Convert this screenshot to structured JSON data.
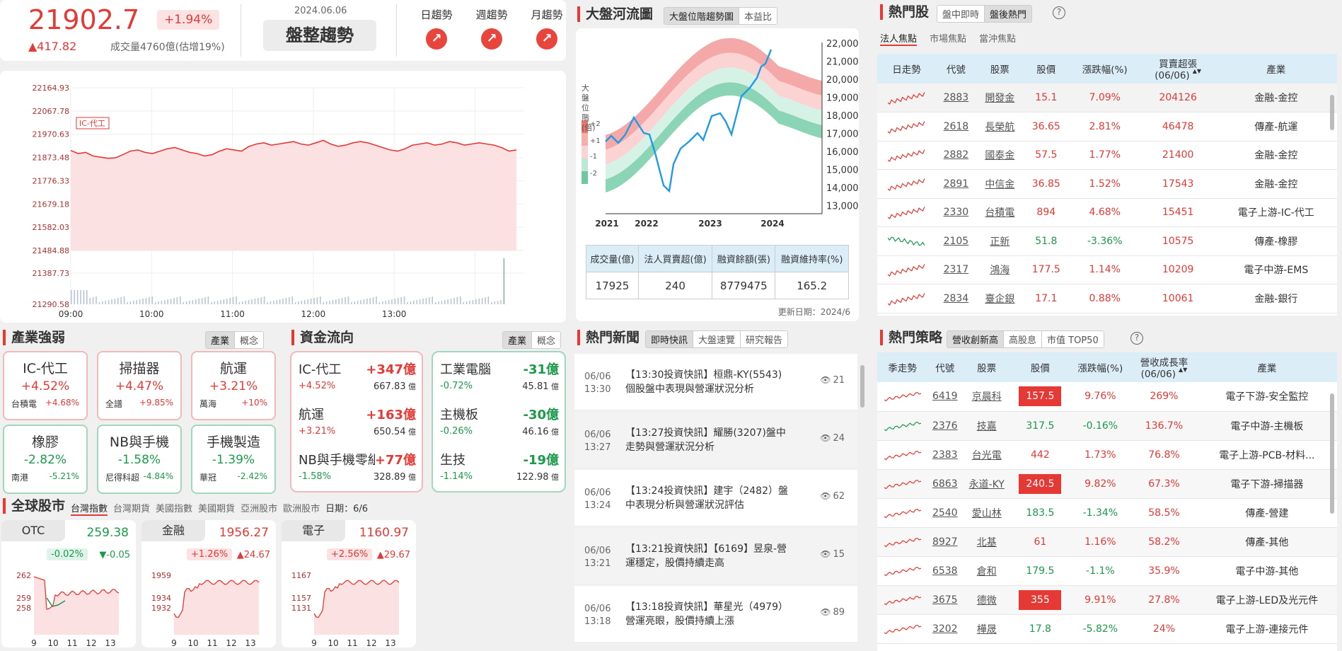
{
  "header": {
    "index": "21902.7",
    "change": "▲417.82",
    "pct": "+1.94%",
    "volume": "成交量4760億(估增19%)",
    "date": "2024.06.06",
    "trend": "盤整趨勢",
    "trend_tabs": [
      "日趨勢",
      "週趨勢",
      "月趨勢"
    ]
  },
  "intraday": {
    "ylabels": [
      "22164.93",
      "22067.78",
      "21970.63",
      "21873.48",
      "21776.33",
      "21679.18",
      "21582.03",
      "21484.88"
    ],
    "vol_labels": [
      "21387.73",
      "21290.58"
    ],
    "xlabels": [
      "09:00",
      "10:00",
      "11:00",
      "12:00",
      "13:00"
    ],
    "annotation": "IC-代工"
  },
  "river": {
    "title": "大盤河流圖",
    "tabs": [
      "大盤位階趨勢圖",
      "本益比"
    ],
    "side_label": "大盤位階(倍)",
    "band_labels": [
      "+2",
      "+1",
      "-1",
      "-2"
    ],
    "yaxis": [
      "22,000",
      "21,000",
      "20,000",
      "19,000",
      "18,000",
      "17,000",
      "16,000",
      "15,000",
      "14,000",
      "13,000"
    ],
    "xaxis": [
      "2021",
      "2022",
      "2023",
      "2024"
    ],
    "table_headers": [
      "成交量(億)",
      "法人買賣超(億)",
      "融資餘額(張)",
      "融資維持率(%)"
    ],
    "table_values": [
      "17925",
      "240",
      "8779475",
      "165.2"
    ],
    "update": "更新日期：2024/6"
  },
  "hot": {
    "title": "熱門股",
    "tabs": [
      "盤中即時",
      "盤後熱門"
    ],
    "subtabs": [
      "法人焦點",
      "市場焦點",
      "當沖焦點"
    ],
    "headers": [
      "日走勢",
      "代號",
      "股票",
      "股價",
      "漲跌幅(%)",
      "買賣超張\n(06/06)",
      "產業"
    ],
    "rows": [
      [
        "2883",
        "開發金",
        "15.1",
        "7.09%",
        "204126",
        "金融-金控"
      ],
      [
        "2618",
        "長榮航",
        "36.65",
        "2.81%",
        "46478",
        "傳產-航運"
      ],
      [
        "2882",
        "國泰金",
        "57.5",
        "1.77%",
        "21400",
        "金融-金控"
      ],
      [
        "2891",
        "中信金",
        "36.85",
        "1.52%",
        "17543",
        "金融-金控"
      ],
      [
        "2330",
        "台積電",
        "894",
        "4.68%",
        "15451",
        "電子上游-IC-代工"
      ],
      [
        "2105",
        "正新",
        "51.8",
        "-3.36%",
        "10575",
        "傳產-橡膠"
      ],
      [
        "2317",
        "鴻海",
        "177.5",
        "1.14%",
        "10209",
        "電子中游-EMS"
      ],
      [
        "2834",
        "臺企銀",
        "17.1",
        "0.88%",
        "10061",
        "金融-銀行"
      ]
    ]
  },
  "sector": {
    "title": "產業強弱",
    "tabs": [
      "產業",
      "概念"
    ],
    "items": [
      {
        "name": "IC-代工",
        "pct": "+4.52%",
        "stock": "台積電",
        "spct": "+4.68%",
        "up": true
      },
      {
        "name": "掃描器",
        "pct": "+4.47%",
        "stock": "全譜",
        "spct": "+9.85%",
        "up": true
      },
      {
        "name": "航運",
        "pct": "+3.21%",
        "stock": "萬海",
        "spct": "+10%",
        "up": true
      },
      {
        "name": "橡膠",
        "pct": "-2.82%",
        "stock": "南港",
        "spct": "-5.21%",
        "up": false
      },
      {
        "name": "NB與手機",
        "pct": "-1.58%",
        "stock": "尼得科超",
        "spct": "-4.84%",
        "up": false
      },
      {
        "name": "手機製造",
        "pct": "-1.39%",
        "stock": "華冠",
        "spct": "-2.42%",
        "up": false
      }
    ]
  },
  "flow": {
    "title": "資金流向",
    "tabs": [
      "產業",
      "概念"
    ],
    "in": [
      {
        "name": "IC-代工",
        "amt": "+347億",
        "pct": "+4.52%",
        "val": "667.83",
        "unit": "億"
      },
      {
        "name": "航運",
        "amt": "+163億",
        "pct": "+3.21%",
        "val": "650.54",
        "unit": "億"
      },
      {
        "name": "NB與手機零組",
        "amt": "+77億",
        "pct": "-1.58%",
        "val": "328.89",
        "unit": "億"
      }
    ],
    "out": [
      {
        "name": "工業電腦",
        "amt": "-31億",
        "pct": "-0.72%",
        "val": "45.81",
        "unit": "億"
      },
      {
        "name": "主機板",
        "amt": "-30億",
        "pct": "-0.26%",
        "val": "46.16",
        "unit": "億"
      },
      {
        "name": "生技",
        "amt": "-19億",
        "pct": "-1.14%",
        "val": "122.98",
        "unit": "億"
      }
    ]
  },
  "global": {
    "title": "全球股市",
    "tabs": [
      "台灣指數",
      "台灣期貨",
      "美國指數",
      "美國期貨",
      "亞洲股市",
      "歐洲股市"
    ],
    "date": "日期：6/6",
    "cards": [
      {
        "name": "OTC",
        "value": "259.38",
        "pct": "-0.02%",
        "chg": "▼-0.05",
        "up": false,
        "yl": [
          "262",
          "259",
          "258"
        ],
        "xl": [
          "9",
          "10",
          "11",
          "12",
          "13"
        ]
      },
      {
        "name": "金融",
        "value": "1956.27",
        "pct": "+1.26%",
        "chg": "▲24.67",
        "up": true,
        "yl": [
          "1959",
          "1934",
          "1932"
        ],
        "xl": [
          "9",
          "10",
          "11",
          "12",
          "13"
        ]
      },
      {
        "name": "電子",
        "value": "1160.97",
        "pct": "+2.56%",
        "chg": "▲29.67",
        "up": true,
        "yl": [
          "1167",
          "1157",
          "1131"
        ],
        "xl": [
          "9",
          "10",
          "11",
          "12",
          "13"
        ]
      }
    ]
  },
  "news": {
    "title": "熱門新聞",
    "tabs": [
      "即時快訊",
      "大盤速覽",
      "研究報告"
    ],
    "items": [
      {
        "d": "06/06",
        "t": "13:30",
        "text": "【13:30投資快訊】桓鼎-KY(5543)個股盤中表現與營運狀況分析",
        "views": "21"
      },
      {
        "d": "06/06",
        "t": "13:27",
        "text": "【13:27投資快訊】耀勝(3207)盤中走勢與營運狀況分析",
        "views": "24"
      },
      {
        "d": "06/06",
        "t": "13:24",
        "text": "【13:24投資快訊】建宇（2482）盤中表現分析與營運狀況評估",
        "views": "62"
      },
      {
        "d": "06/06",
        "t": "13:21",
        "text": "【13:21投資快訊】【6169】昱泉-營運穩定，股價持續走高",
        "views": "15"
      },
      {
        "d": "06/06",
        "t": "13:18",
        "text": "【13:18投資快訊】華星光（4979）營運亮眼，股價持續上漲",
        "views": "89"
      }
    ]
  },
  "strategy": {
    "title": "熱門策略",
    "tabs": [
      "營收創新高",
      "高股息",
      "市值 TOP50"
    ],
    "headers": [
      "季走勢",
      "代號",
      "股票",
      "股價",
      "漲跌幅(%)",
      "營收成長率\n(06/06)",
      "產業"
    ],
    "rows": [
      [
        "6419",
        "京晨科",
        "157.5",
        "9.76%",
        "269%",
        "電子下游-安全監控",
        true
      ],
      [
        "2376",
        "技嘉",
        "317.5",
        "-0.16%",
        "136.7%",
        "電子中游-主機板",
        false
      ],
      [
        "2383",
        "台光電",
        "442",
        "1.73%",
        "76.8%",
        "電子上游-PCB-材料...",
        false
      ],
      [
        "6863",
        "永道-KY",
        "240.5",
        "9.82%",
        "67.3%",
        "電子下游-掃描器",
        true
      ],
      [
        "2540",
        "愛山林",
        "183.5",
        "-1.34%",
        "58.5%",
        "傳產-營建",
        false
      ],
      [
        "8927",
        "北基",
        "61",
        "1.16%",
        "58.2%",
        "傳產-其他",
        false
      ],
      [
        "6538",
        "倉和",
        "179.5",
        "-1.1%",
        "35.9%",
        "電子中游-其他",
        false
      ],
      [
        "3675",
        "德微",
        "355",
        "9.91%",
        "27.8%",
        "電子上游-LED及光元件",
        true
      ],
      [
        "3202",
        "樺晟",
        "17.8",
        "-5.82%",
        "24%",
        "電子上游-連接元件",
        false
      ]
    ]
  }
}
